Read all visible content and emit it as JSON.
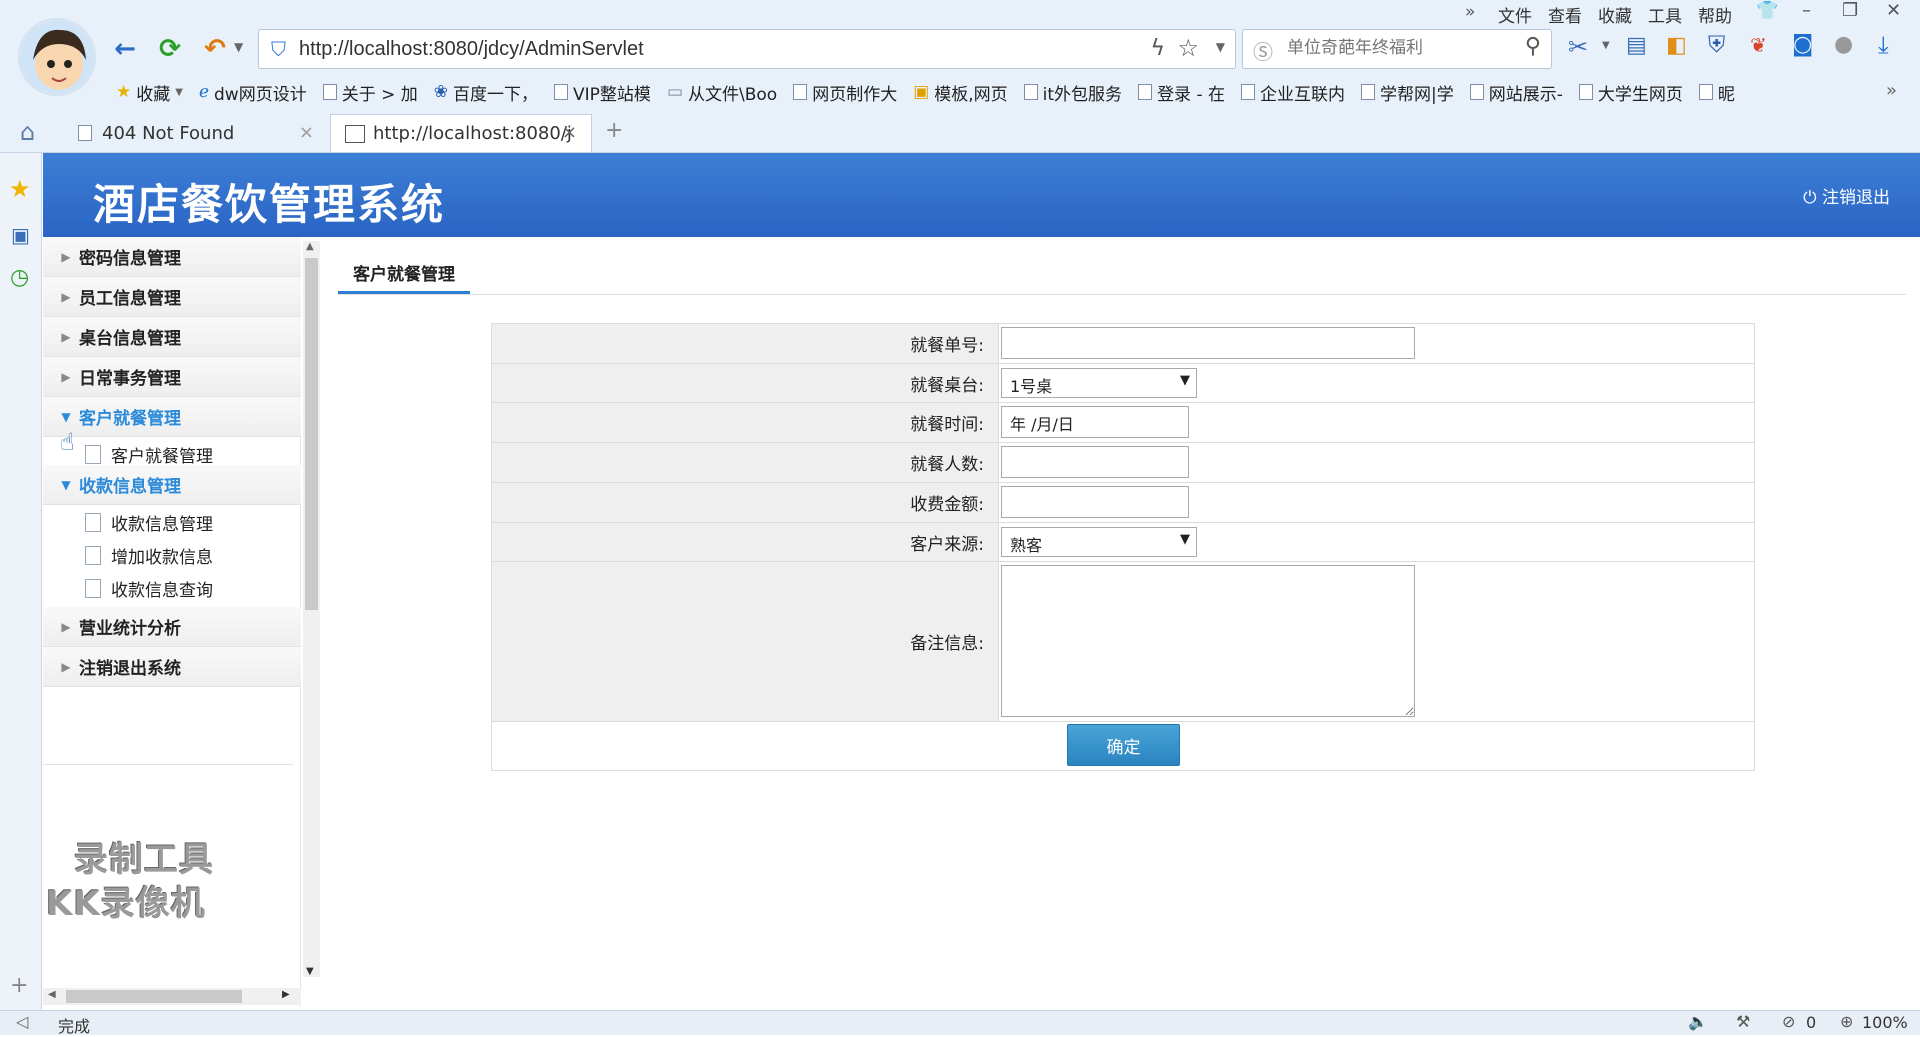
{
  "browser": {
    "url": "http://localhost:8080/jdcy/AdminServlet",
    "search_placeholder": "单位奇葩年终福利",
    "top_menu": [
      "文件",
      "查看",
      "收藏",
      "工具",
      "帮助"
    ],
    "bookmarks": [
      "收藏",
      "dw网页设计",
      "关于 > 加",
      "百度一下，",
      "VIP整站模",
      "从文件\\Boo",
      "网页制作大",
      "模板,网页",
      "it外包服务",
      "登录 - 在",
      "企业互联内",
      "学帮网|学",
      "网站展示-",
      "大学生网页",
      "昵"
    ],
    "tabs": [
      "404 Not Found",
      "http://localhost:8080/j"
    ],
    "status_text": "完成",
    "status_count": "0",
    "zoom": "100%"
  },
  "app": {
    "title": "酒店餐饮管理系统",
    "logout": "注销退出"
  },
  "menu": {
    "items": [
      {
        "label": "密码信息管理",
        "open": false
      },
      {
        "label": "员工信息管理",
        "open": false
      },
      {
        "label": "桌台信息管理",
        "open": false
      },
      {
        "label": "日常事务管理",
        "open": false
      },
      {
        "label": "客户就餐管理",
        "open": true
      },
      {
        "label": "收款信息管理",
        "open": true
      },
      {
        "label": "营业统计分析",
        "open": false
      },
      {
        "label": "注销退出系统",
        "open": false
      }
    ],
    "sub_dining": [
      "客户就餐管理"
    ],
    "sub_payment": [
      "收款信息管理",
      "增加收款信息",
      "收款信息查询"
    ]
  },
  "watermark": [
    "录制工具",
    "KK录像机"
  ],
  "content": {
    "tab": "客户就餐管理",
    "form": {
      "order_no_label": "就餐单号:",
      "order_no_value": "",
      "table_label": "就餐桌台:",
      "table_value": "1号桌",
      "time_label": "就餐时间:",
      "time_value": "年 /月/日",
      "people_label": "就餐人数:",
      "people_value": "",
      "fee_label": "收费金额:",
      "fee_value": "",
      "source_label": "客户来源:",
      "source_value": "熟客",
      "remark_label": "备注信息:",
      "remark_value": "",
      "submit": "确定"
    }
  },
  "colors": {
    "header_blue": "#2f6ccb",
    "menu_active": "#2b8ad9",
    "button": "#2b84c0"
  }
}
